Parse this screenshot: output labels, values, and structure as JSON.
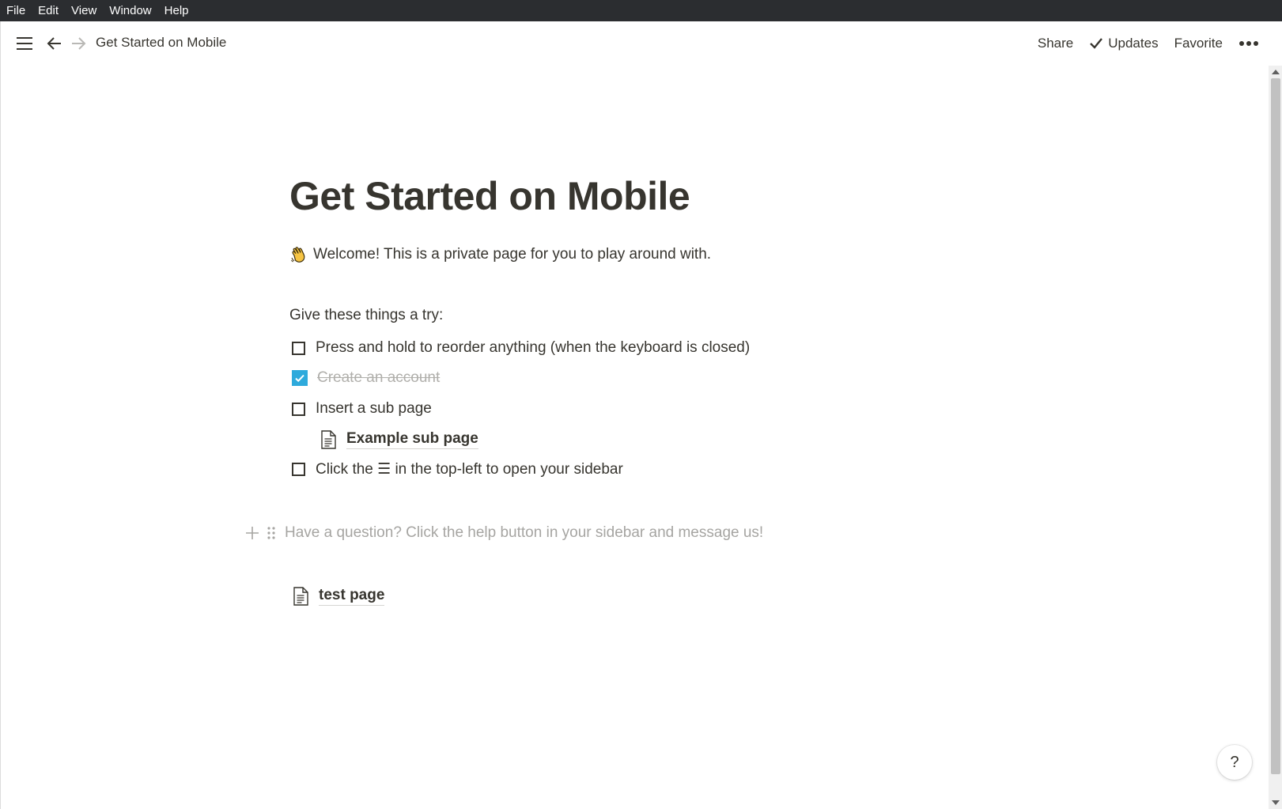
{
  "menubar": {
    "items": [
      "File",
      "Edit",
      "View",
      "Window",
      "Help"
    ]
  },
  "topbar": {
    "breadcrumb": "Get Started on Mobile",
    "share_label": "Share",
    "updates_label": "Updates",
    "favorite_label": "Favorite",
    "more_label": "•••"
  },
  "page": {
    "title": "Get Started on Mobile",
    "welcome_text": "Welcome! This is a private page for you to play around with.",
    "intro_text": "Give these things a try:",
    "todos": [
      {
        "label": "Press and hold to reorder anything (when the keyboard is closed)",
        "checked": false
      },
      {
        "label": "Create an account",
        "checked": true
      },
      {
        "label": "Insert a sub page",
        "checked": false
      },
      {
        "label": "Click the ☰ in the top-left to open your sidebar",
        "checked": false
      }
    ],
    "subpage_label": "Example sub page",
    "placeholder_text": "Have a question? Click the help button in your sidebar and message us!",
    "testpage_label": "test page"
  },
  "help_button_label": "?",
  "colors": {
    "menubar_bg": "#2b2d30",
    "text": "#37352f",
    "checkbox_checked": "#2eaadc",
    "placeholder": "#a6a5a2"
  }
}
